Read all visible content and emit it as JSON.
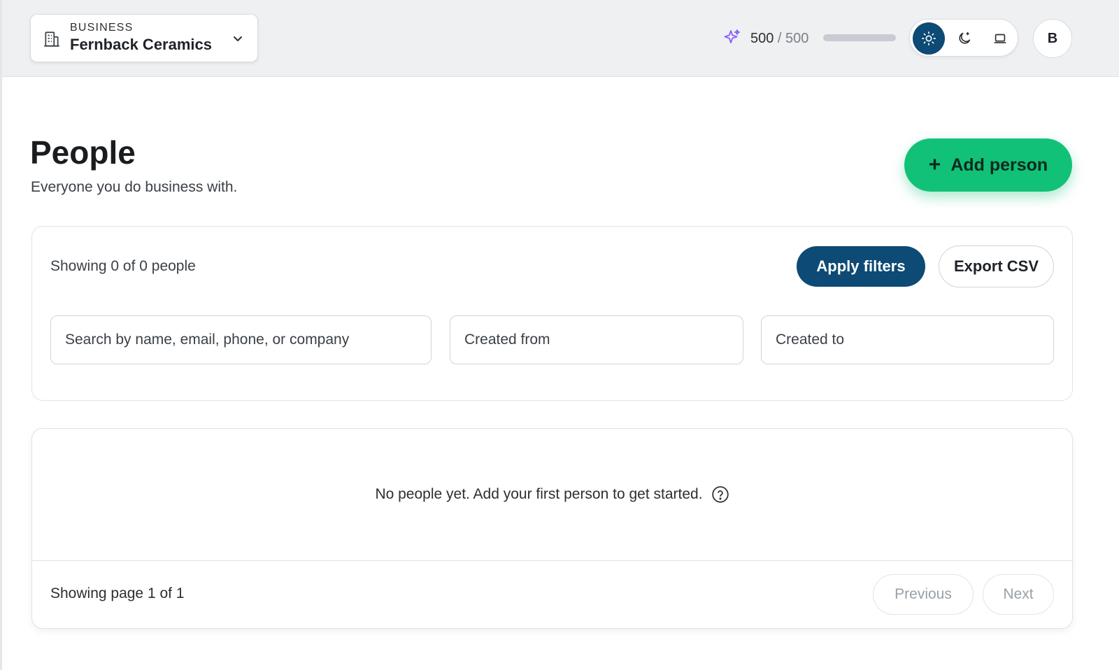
{
  "topbar": {
    "business_kicker": "BUSINESS",
    "business_name": "Fernback Ceramics",
    "credits_used": "500",
    "credits_separator": " / ",
    "credits_total": "500",
    "credits_fill_fraction": 1.0,
    "theme_options": [
      "light",
      "dark",
      "system"
    ],
    "theme_active": "light",
    "avatar_initial": "B",
    "accent_color": "#0d4a75",
    "sparkle_color": "#8b5cf6"
  },
  "header": {
    "title": "People",
    "subtitle": "Everyone you do business with.",
    "add_button_label": "Add person",
    "add_button_color": "#12c178"
  },
  "filters": {
    "showing_text": "Showing 0 of 0 people",
    "apply_label": "Apply filters",
    "export_label": "Export CSV",
    "search_placeholder": "Search by name, email, phone, or company",
    "search_value": "",
    "created_from_placeholder": "Created from",
    "created_to_placeholder": "Created to"
  },
  "results": {
    "empty_message": "No people yet. Add your first person to get started.",
    "page_info": "Showing page 1 of 1",
    "previous_label": "Previous",
    "next_label": "Next"
  }
}
